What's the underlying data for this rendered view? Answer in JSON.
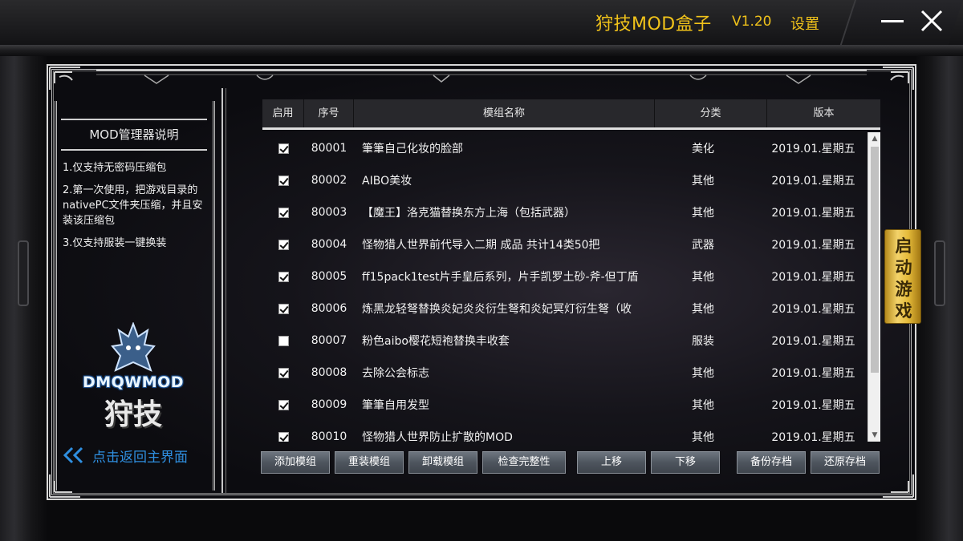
{
  "window": {
    "title": "狩技MOD盒子",
    "version": "V1.20",
    "settings_label": "设置",
    "minimize_icon": "minimize-icon",
    "close_icon": "close-icon",
    "accent_color": "#f0c21a"
  },
  "sidebar": {
    "title": "MOD管理器说明",
    "notes": [
      "1.仅支持无密码压缩包",
      "2.第一次使用，把游戏目录的nativePC文件夹压缩，并且安装该压缩包",
      "3.仅支持服装一键换装"
    ],
    "logo_text": "DMQWMOD",
    "logo_text_cn": "狩技",
    "back_label": "点击返回主界面",
    "back_color": "#2f8fe0"
  },
  "table": {
    "columns": [
      "启用",
      "序号",
      "模组名称",
      "分类",
      "版本"
    ],
    "rows": [
      {
        "enabled": true,
        "id": "80001",
        "name": "筆筆自己化妆的脸部",
        "category": "美化",
        "version": "2019.01.星期五"
      },
      {
        "enabled": true,
        "id": "80002",
        "name": "AIBO美妆",
        "category": "其他",
        "version": "2019.01.星期五"
      },
      {
        "enabled": true,
        "id": "80003",
        "name": "【魔王】洛克猫替换东方上海（包括武器）",
        "category": "其他",
        "version": "2019.01.星期五"
      },
      {
        "enabled": true,
        "id": "80004",
        "name": "怪物猎人世界前代导入二期 成品 共计14类50把",
        "category": "武器",
        "version": "2019.01.星期五"
      },
      {
        "enabled": true,
        "id": "80005",
        "name": "ff15pack1test片手皇后系列，片手凯罗土砂-斧-但丁盾",
        "category": "其他",
        "version": "2019.01.星期五"
      },
      {
        "enabled": true,
        "id": "80006",
        "name": "炼黑龙轻弩替换炎妃炎炎衍生弩和炎妃冥灯衍生弩（收",
        "category": "其他",
        "version": "2019.01.星期五"
      },
      {
        "enabled": false,
        "id": "80007",
        "name": "粉色aibo樱花短袍替换丰收套",
        "category": "服装",
        "version": "2019.01.星期五"
      },
      {
        "enabled": true,
        "id": "80008",
        "name": "去除公会标志",
        "category": "其他",
        "version": "2019.01.星期五"
      },
      {
        "enabled": true,
        "id": "80009",
        "name": "筆筆自用发型",
        "category": "其他",
        "version": "2019.01.星期五"
      },
      {
        "enabled": true,
        "id": "80010",
        "name": "怪物猎人世界防止扩散的MOD",
        "category": "其他",
        "version": "2019.01.星期五"
      }
    ]
  },
  "actions": {
    "add": "添加模组",
    "reinstall": "重装模组",
    "uninstall": "卸载模组",
    "check": "检查完整性",
    "move_up": "上移",
    "move_down": "下移",
    "backup": "备份存档",
    "restore": "还原存档"
  },
  "launch": {
    "chars": [
      "启",
      "动",
      "游",
      "戏"
    ],
    "color": "#e5bb3a"
  }
}
